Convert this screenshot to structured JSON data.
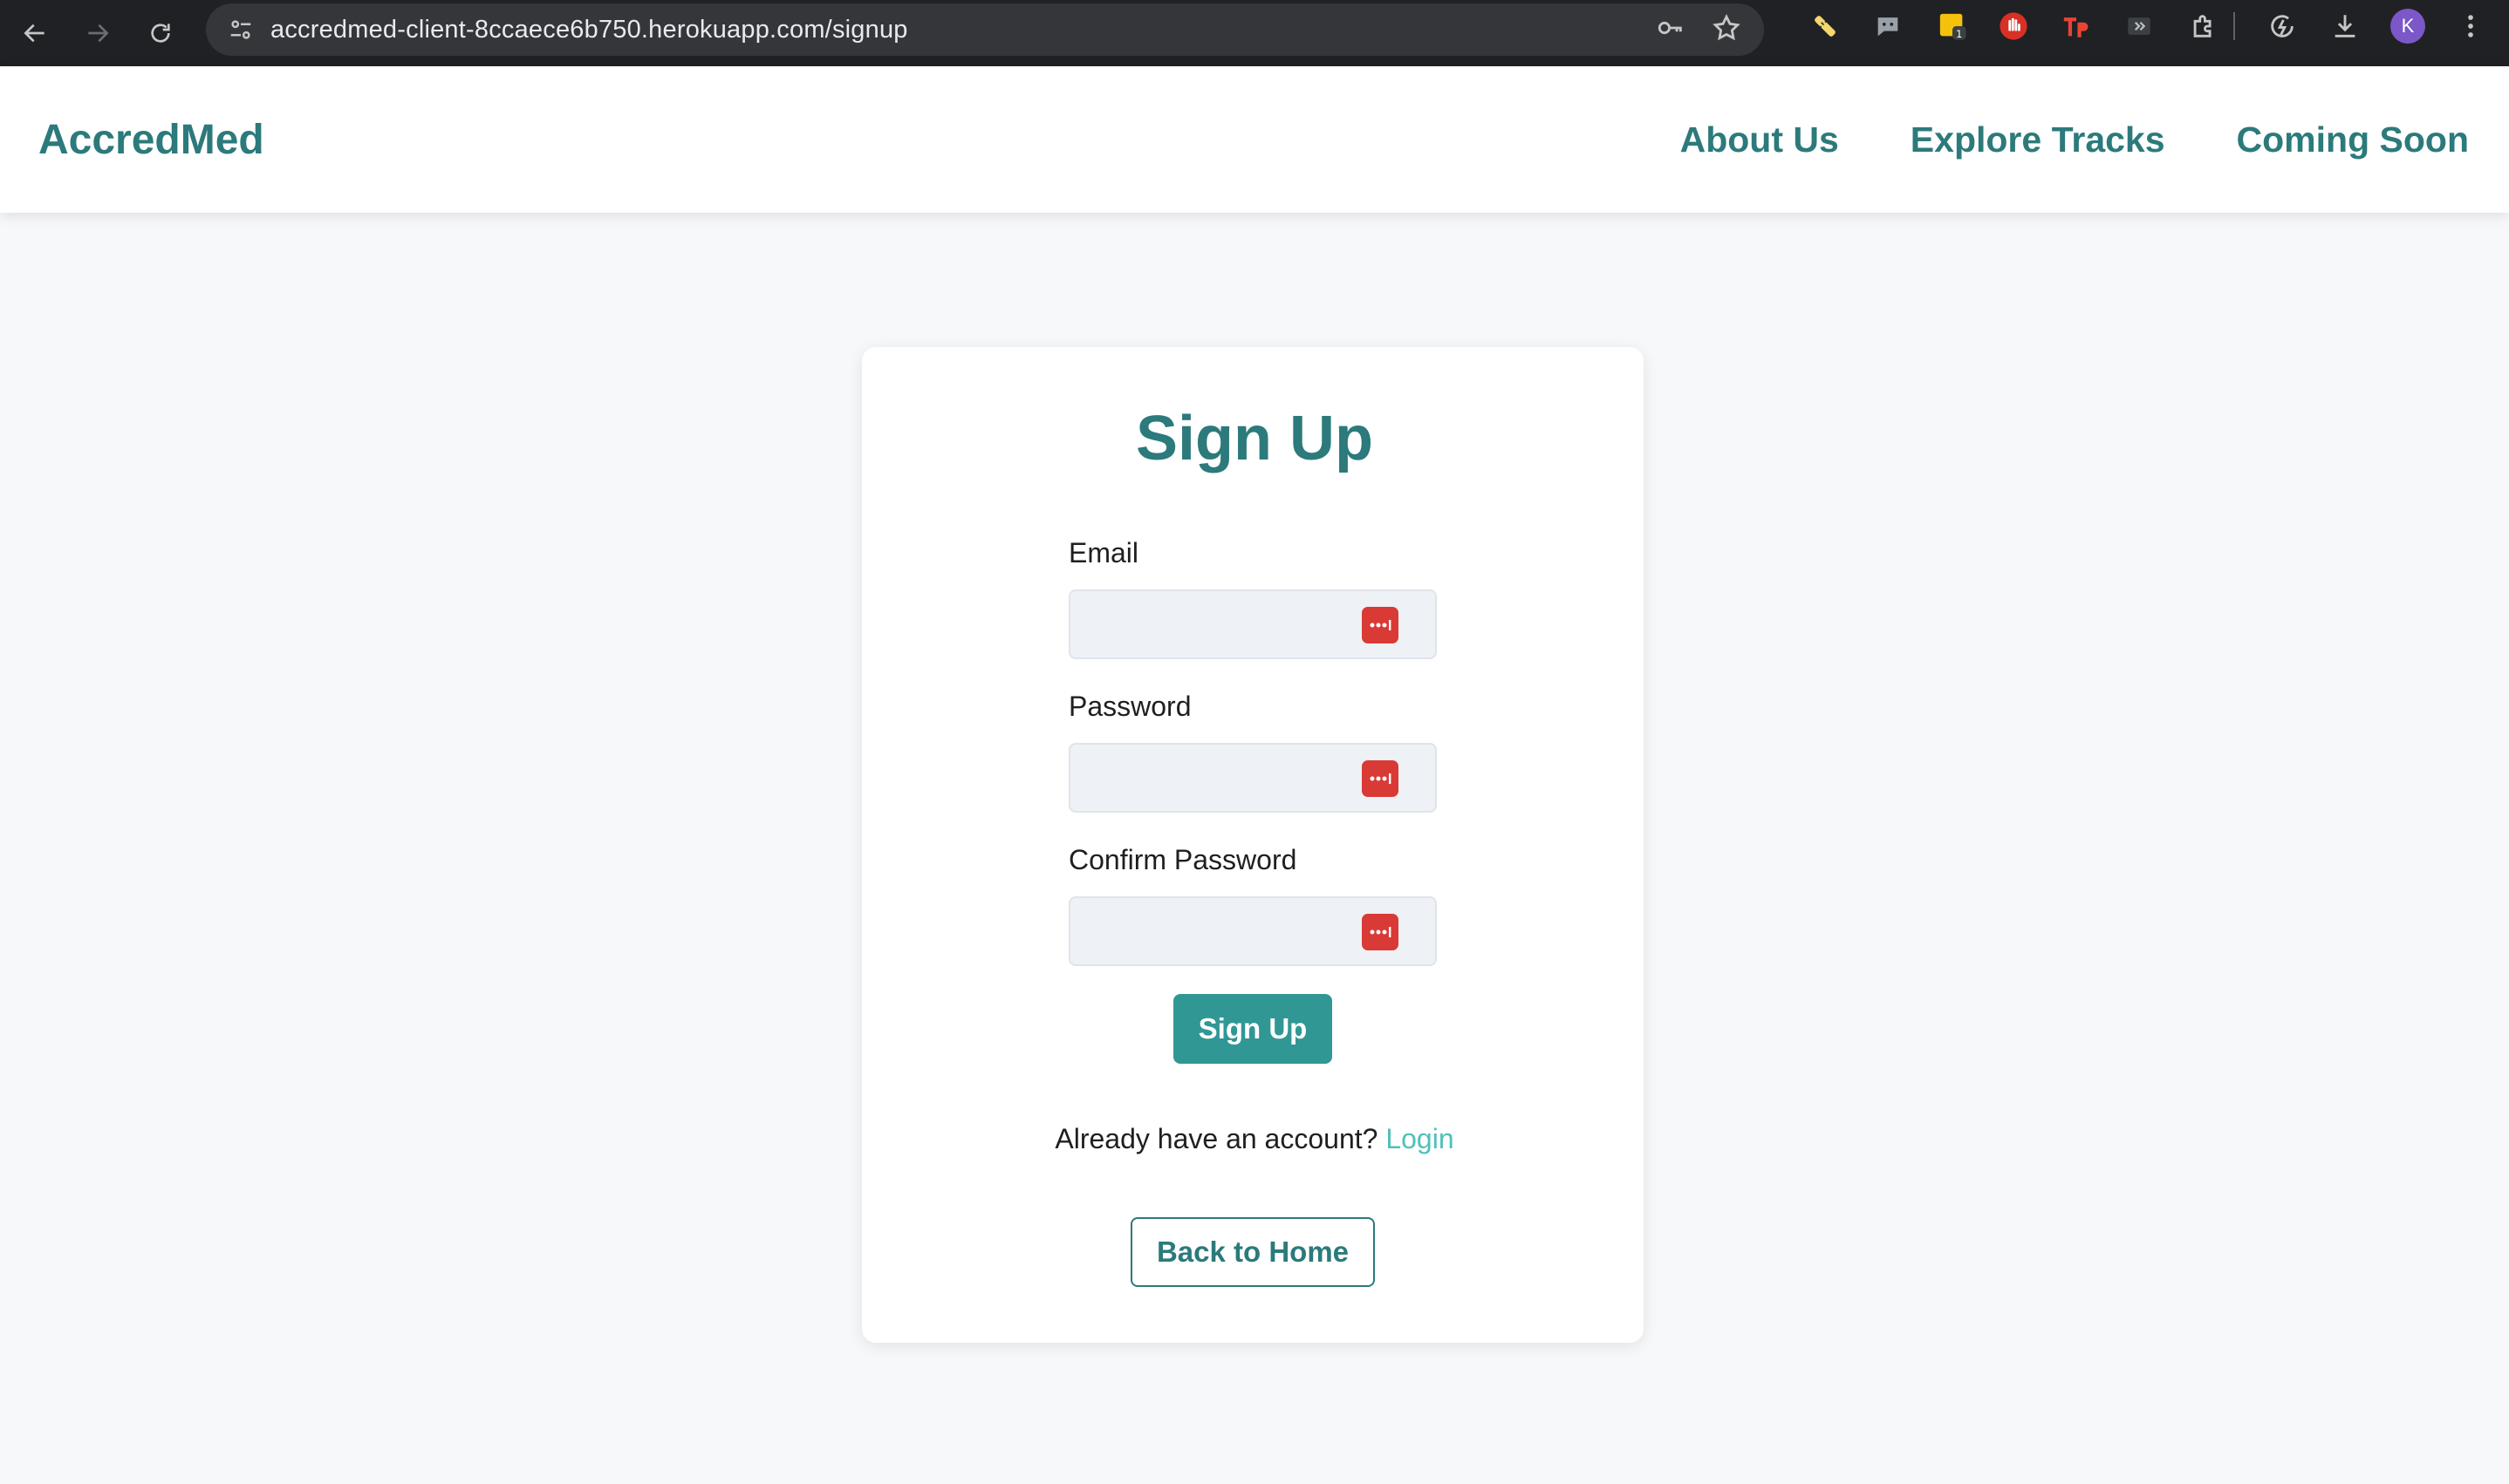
{
  "browser": {
    "url": "accredmed-client-8ccaece6b750.herokuapp.com/signup",
    "profile_initial": "K",
    "extension_badge": "1"
  },
  "header": {
    "brand": "AccredMed",
    "nav": [
      "About Us",
      "Explore Tracks",
      "Coming Soon"
    ]
  },
  "form": {
    "title": "Sign Up",
    "fields": [
      {
        "label": "Email",
        "value": ""
      },
      {
        "label": "Password",
        "value": ""
      },
      {
        "label": "Confirm Password",
        "value": ""
      }
    ],
    "submit_label": "Sign Up",
    "account_prompt": "Already have an account?",
    "login_link": "Login",
    "back_label": "Back to Home"
  },
  "colors": {
    "brand": "#2c7a7b",
    "primary_button": "#319795",
    "link": "#4fc1b9",
    "password_manager_icon": "#d93a36"
  }
}
